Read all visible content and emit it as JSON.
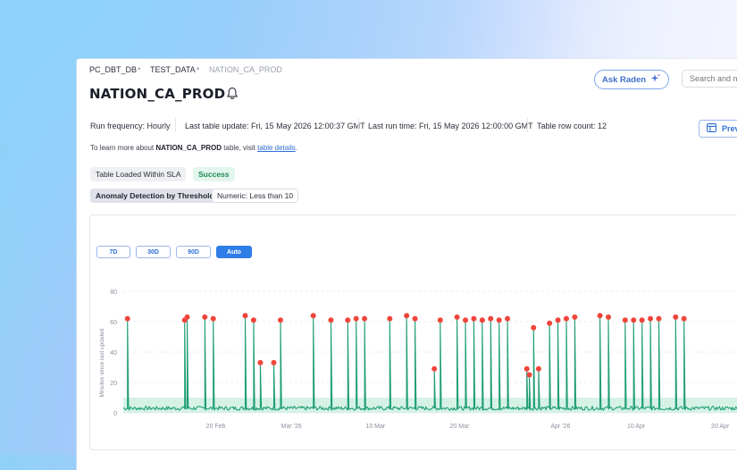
{
  "breadcrumb": [
    "PC_DBT_DB",
    "TEST_DATA",
    "NATION_CA_PROD"
  ],
  "page_title": "NATION_CA_PROD",
  "header": {
    "ask_label": "Ask Raden",
    "search_placeholder": "Search and n",
    "preview_label": "Prev"
  },
  "meta": {
    "run_frequency": "Run frequency: Hourly",
    "last_update": "Last table update: Fri, 15 May 2026 12:00:37 GMT",
    "last_run": "Last run time: Fri, 15 May 2026 12:00:00 GMT",
    "row_count": "Table row count: 12"
  },
  "info": {
    "prefix": "To learn more about",
    "table": "NATION_CA_PROD",
    "middle": "table, visit",
    "link": "table details",
    "suffix": "."
  },
  "checks": {
    "sla_label": "Table Loaded Within SLA",
    "sla_status": "Success",
    "anomaly_label": "Anomaly Detection by Thresholds",
    "anomaly_rule": "Numeric: Less than 10"
  },
  "ranges": [
    "7D",
    "30D",
    "90D",
    "Auto"
  ],
  "active_range": "Auto",
  "colors": {
    "accent": "#2f7de6",
    "line": "#1f9e73",
    "anomaly": "#f0453a",
    "band": "#c8eedd"
  },
  "chart_data": {
    "type": "line",
    "title": "",
    "xlabel": "",
    "ylabel": "Minutes since last updated",
    "ylim": [
      0,
      80
    ],
    "yticks": [
      0,
      20,
      40,
      60,
      80
    ],
    "x_ticks": [
      {
        "label": "20 Feb",
        "day": 11
      },
      {
        "label": "Mar '26",
        "day": 20
      },
      {
        "label": "10 Mar",
        "day": 30
      },
      {
        "label": "20 Mar",
        "day": 40
      },
      {
        "label": "Apr '26",
        "day": 52
      },
      {
        "label": "10 Apr",
        "day": 61
      },
      {
        "label": "20 Apr",
        "day": 71
      }
    ],
    "xlim": [
      0,
      73
    ],
    "threshold_band": [
      0,
      10
    ],
    "baseline": 3,
    "grid": true,
    "spikes": [
      {
        "day": 0.5,
        "value": 62,
        "anomaly": true
      },
      {
        "day": 7.3,
        "value": 61,
        "anomaly": true
      },
      {
        "day": 7.6,
        "value": 63,
        "anomaly": true
      },
      {
        "day": 9.7,
        "value": 63,
        "anomaly": true
      },
      {
        "day": 10.7,
        "value": 62,
        "anomaly": true
      },
      {
        "day": 14.5,
        "value": 64,
        "anomaly": true
      },
      {
        "day": 15.5,
        "value": 61,
        "anomaly": true
      },
      {
        "day": 16.3,
        "value": 33,
        "anomaly": true
      },
      {
        "day": 17.9,
        "value": 33,
        "anomaly": true
      },
      {
        "day": 18.7,
        "value": 61,
        "anomaly": true
      },
      {
        "day": 22.6,
        "value": 64,
        "anomaly": true
      },
      {
        "day": 24.7,
        "value": 61,
        "anomaly": true
      },
      {
        "day": 26.7,
        "value": 61,
        "anomaly": true
      },
      {
        "day": 27.7,
        "value": 62,
        "anomaly": true
      },
      {
        "day": 28.7,
        "value": 62,
        "anomaly": true
      },
      {
        "day": 31.7,
        "value": 62,
        "anomaly": true
      },
      {
        "day": 33.7,
        "value": 64,
        "anomaly": true
      },
      {
        "day": 34.7,
        "value": 62,
        "anomaly": true
      },
      {
        "day": 37.0,
        "value": 29,
        "anomaly": true
      },
      {
        "day": 37.7,
        "value": 61,
        "anomaly": true
      },
      {
        "day": 39.7,
        "value": 63,
        "anomaly": true
      },
      {
        "day": 40.7,
        "value": 61,
        "anomaly": true
      },
      {
        "day": 41.7,
        "value": 62,
        "anomaly": true
      },
      {
        "day": 42.7,
        "value": 61,
        "anomaly": true
      },
      {
        "day": 43.7,
        "value": 62,
        "anomaly": true
      },
      {
        "day": 44.7,
        "value": 61,
        "anomaly": true
      },
      {
        "day": 45.7,
        "value": 62,
        "anomaly": true
      },
      {
        "day": 48.0,
        "value": 29,
        "anomaly": true
      },
      {
        "day": 48.3,
        "value": 25,
        "anomaly": true
      },
      {
        "day": 48.8,
        "value": 56,
        "anomaly": true
      },
      {
        "day": 49.4,
        "value": 29,
        "anomaly": true
      },
      {
        "day": 50.7,
        "value": 59,
        "anomaly": true
      },
      {
        "day": 51.7,
        "value": 61,
        "anomaly": true
      },
      {
        "day": 52.7,
        "value": 62,
        "anomaly": true
      },
      {
        "day": 53.7,
        "value": 63,
        "anomaly": true
      },
      {
        "day": 56.7,
        "value": 64,
        "anomaly": true
      },
      {
        "day": 57.7,
        "value": 63,
        "anomaly": true
      },
      {
        "day": 59.7,
        "value": 61,
        "anomaly": true
      },
      {
        "day": 60.7,
        "value": 61,
        "anomaly": true
      },
      {
        "day": 61.7,
        "value": 61,
        "anomaly": true
      },
      {
        "day": 62.7,
        "value": 62,
        "anomaly": true
      },
      {
        "day": 63.7,
        "value": 62,
        "anomaly": true
      },
      {
        "day": 65.7,
        "value": 63,
        "anomaly": true
      },
      {
        "day": 66.7,
        "value": 62,
        "anomaly": true
      }
    ]
  }
}
